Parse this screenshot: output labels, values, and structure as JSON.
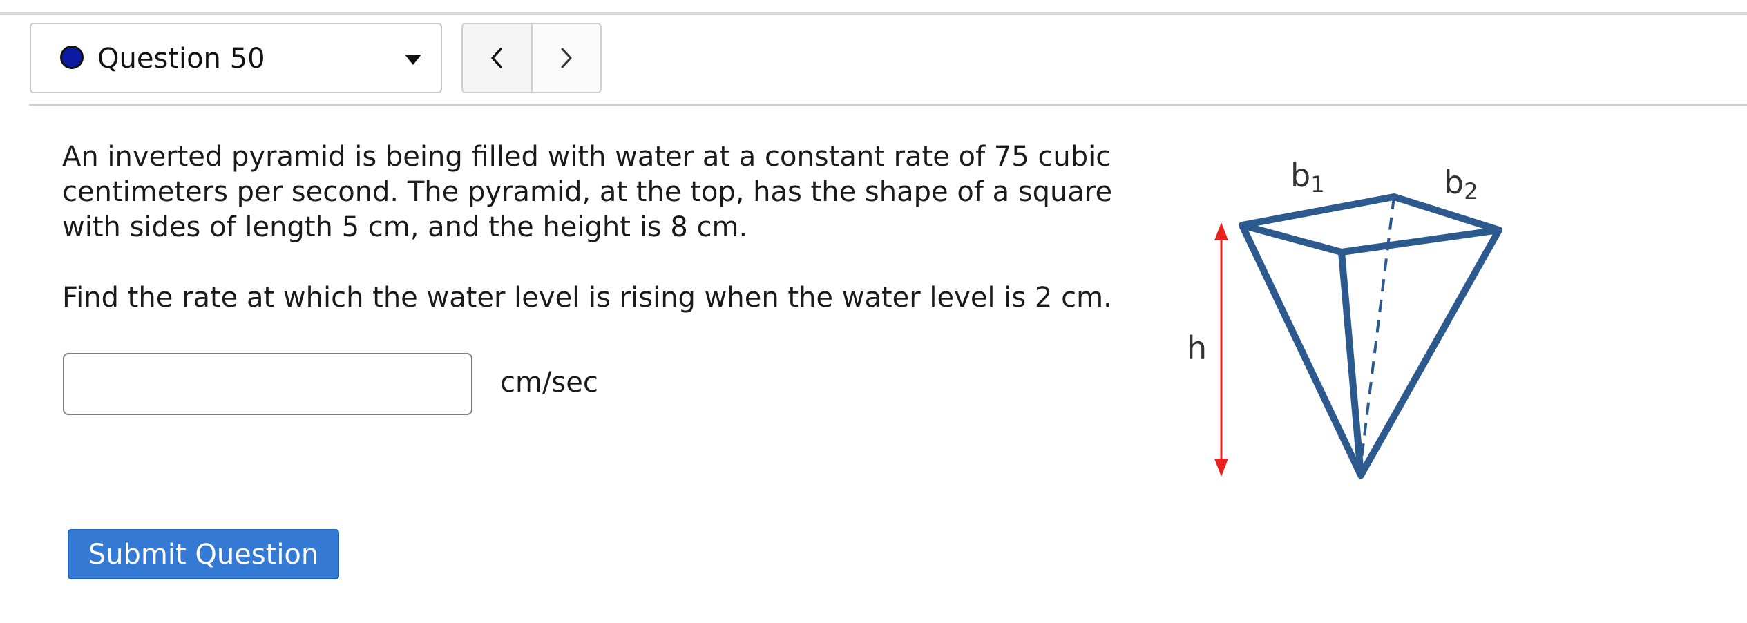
{
  "question_selector": {
    "label": "Question 50",
    "status_color": "#0c1aa3"
  },
  "navigation": {
    "prev_icon": "chevron-left-icon",
    "next_icon": "chevron-right-icon"
  },
  "question": {
    "paragraph_1": "An inverted pyramid is being filled with water at a constant rate of 75 cubic centimeters per second. The pyramid, at the top, has the shape of a square with sides of length 5 cm, and the height is 8 cm.",
    "paragraph_2": "Find the rate at which the water level is rising when the water level is 2 cm."
  },
  "answer": {
    "value": "",
    "unit": "cm/sec"
  },
  "figure": {
    "label_b1_base": "b",
    "label_b1_sub": "1",
    "label_b2_base": "b",
    "label_b2_sub": "2",
    "label_h": "h",
    "pyramid_color": "#2d5a8e",
    "arrow_color": "#e8211f"
  },
  "submit": {
    "label": "Submit Question",
    "color": "#3479d4"
  }
}
